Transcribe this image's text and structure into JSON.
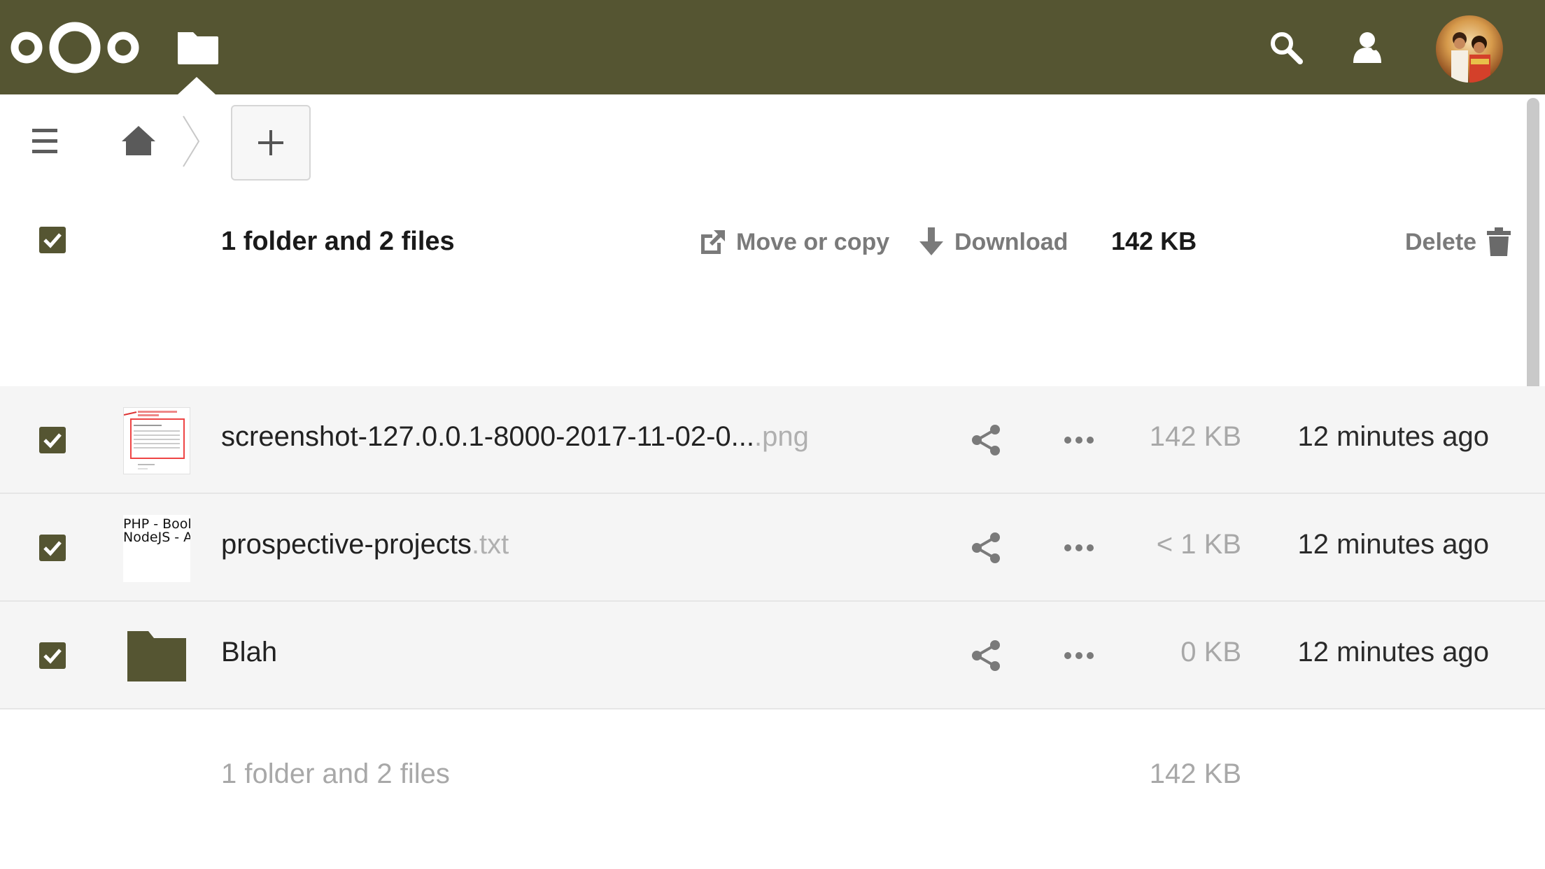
{
  "theme": {
    "header_color": "#555532",
    "accent": "#555532"
  },
  "header": {
    "logo_icon": "nextcloud-logo",
    "app_icon": "folder-icon",
    "search_icon": "search-icon",
    "contacts_icon": "contacts-icon",
    "avatar": "user-avatar"
  },
  "controls": {
    "menu_icon": "hamburger-icon",
    "home_icon": "home-icon",
    "new_label": "+"
  },
  "selection": {
    "count_label": "1 folder and 2 files",
    "move_copy_label": "Move or copy",
    "download_label": "Download",
    "size": "142 KB",
    "delete_label": "Delete"
  },
  "files": [
    {
      "name": "screenshot-127.0.0.1-8000-2017-11-02-0...",
      "ext": ".png",
      "size": "142 KB",
      "modified": "12 minutes ago",
      "type": "image",
      "checked": true
    },
    {
      "name": "prospective-projects",
      "ext": ".txt",
      "size": "< 1 KB",
      "modified": "12 minutes ago",
      "type": "text",
      "checked": true,
      "preview_lines": [
        "PHP - Bool",
        "NodeJS - A"
      ]
    },
    {
      "name": "Blah",
      "ext": "",
      "size": "0 KB",
      "modified": "12 minutes ago",
      "type": "folder",
      "checked": true
    }
  ],
  "summary": {
    "label": "1 folder and 2 files",
    "size": "142 KB"
  }
}
